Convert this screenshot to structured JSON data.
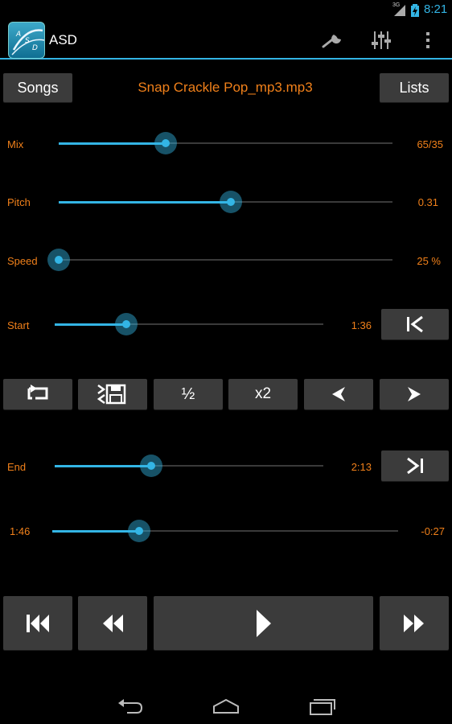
{
  "status_bar": {
    "network": "3G",
    "time": "8:21"
  },
  "app": {
    "title": "ASD",
    "icon_letters": [
      "A",
      "S",
      "D"
    ]
  },
  "toolbar": {
    "settings_icon": "wrench-icon",
    "equalizer_icon": "sliders-icon",
    "overflow_icon": "more-vert-icon"
  },
  "header": {
    "songs_button": "Songs",
    "song_title": "Snap Crackle Pop_mp3.mp3",
    "lists_button": "Lists"
  },
  "sliders": {
    "mix": {
      "label": "Mix",
      "value": "65/35",
      "level": 0.32
    },
    "pitch": {
      "label": "Pitch",
      "value": "0.31",
      "level": 0.515
    },
    "speed": {
      "label": "Speed",
      "value": "25 %",
      "level": 0.0
    },
    "start": {
      "label": "Start",
      "value": "1:36",
      "level": 0.265
    },
    "end": {
      "label": "End",
      "value": "2:13",
      "level": 0.36
    },
    "position": {
      "elapsed": "1:46",
      "remaining": "-0:27",
      "level": 0.25
    }
  },
  "loop_controls": {
    "loop_icon": "repeat-icon",
    "save_icon": "save-loop-icon",
    "half_label": "½",
    "double_label": "x2",
    "prev_icon": "chevron-left-icon",
    "next_icon": "chevron-right-icon"
  },
  "transport": {
    "skip_back_icon": "skip-back-icon",
    "rewind_icon": "rewind-icon",
    "play_icon": "play-icon",
    "fast_forward_icon": "fast-forward-icon"
  },
  "colors": {
    "accent": "#33b5e5",
    "label": "#f0801a",
    "button": "#3b3b3b",
    "background": "#000000"
  }
}
